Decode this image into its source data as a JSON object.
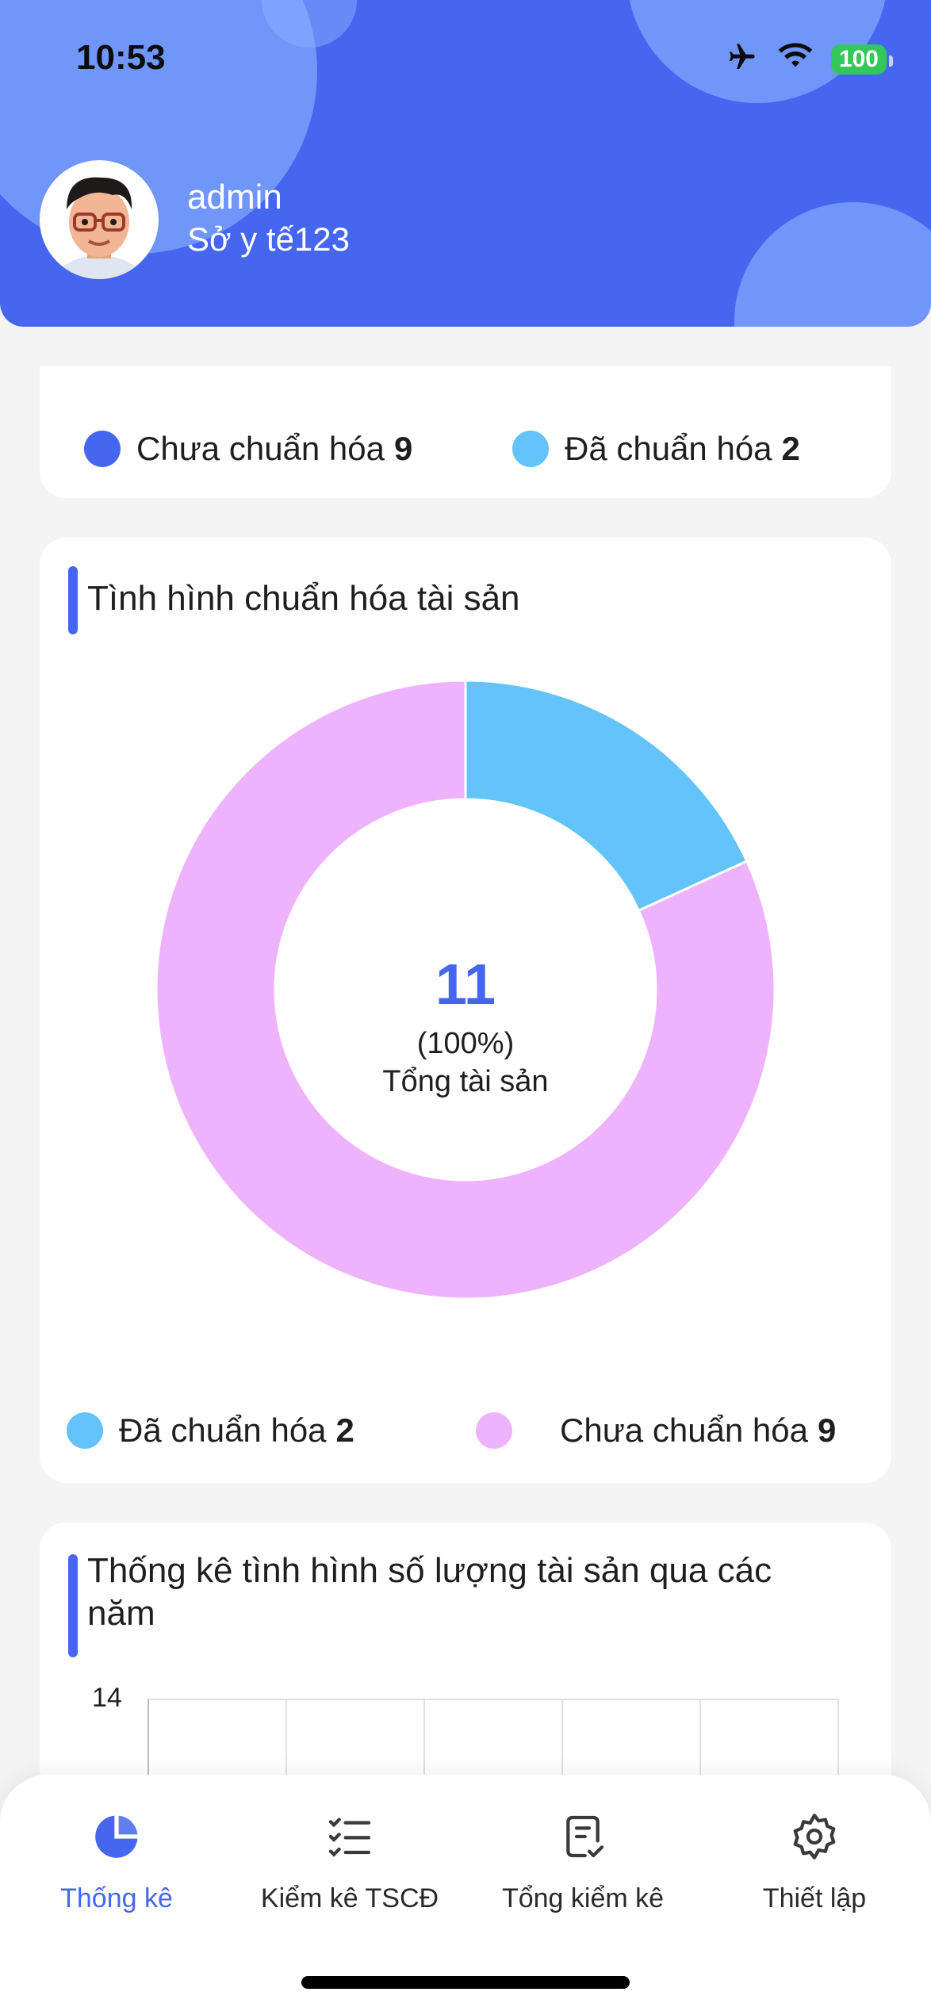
{
  "status_bar": {
    "time": "10:53",
    "battery": "100"
  },
  "user": {
    "name": "admin",
    "org": "Sở y tế123"
  },
  "top_legend": [
    {
      "label": "Chưa chuẩn hóa",
      "value": "9",
      "color": "#4567ef"
    },
    {
      "label": "Đã chuẩn hóa",
      "value": "2",
      "color": "#63c3fa"
    }
  ],
  "donut_card": {
    "title": "Tình hình chuẩn hóa tài sản",
    "center_value": "11",
    "center_percent": "(100%)",
    "center_label": "Tổng tài sản",
    "legend": [
      {
        "label": "Đã chuẩn hóa",
        "value": "2",
        "color": "#63c3fa"
      },
      {
        "label": "Chưa chuẩn hóa",
        "value": "9",
        "color": "#efb3fd"
      }
    ]
  },
  "chart_data": {
    "type": "pie",
    "categories": [
      "Đã chuẩn hóa",
      "Chưa chuẩn hóa"
    ],
    "values": [
      2,
      9
    ],
    "colors": [
      "#63c3fa",
      "#efb3fd"
    ],
    "donut": true
  },
  "bar_card": {
    "title_line1": "Thống kê tình hình số lượng tài sản qua các",
    "title_line2": "năm",
    "y_tick_top": "14"
  },
  "nav": [
    {
      "label": "Thống kê",
      "icon": "pie-chart-icon",
      "active": true
    },
    {
      "label": "Kiểm kê TSCĐ",
      "icon": "checklist-icon",
      "active": false
    },
    {
      "label": "Tổng kiểm kê",
      "icon": "document-check-icon",
      "active": false
    },
    {
      "label": "Thiết lập",
      "icon": "gear-icon",
      "active": false
    }
  ],
  "colors": {
    "primary": "#4567ef",
    "header_bg": "#4567ef",
    "card_bg": "#ffffff",
    "page_bg": "#f4f4f5"
  }
}
